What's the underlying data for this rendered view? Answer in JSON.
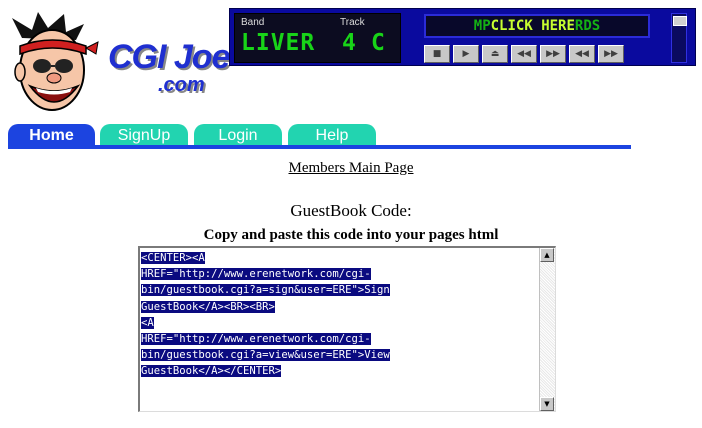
{
  "logo": {
    "text": "CGI Joe",
    "sub": ".com"
  },
  "player": {
    "band_label": "Band",
    "track_label": "Track",
    "band_value": "LIVER",
    "track_value": "4",
    "track_suffix": "C",
    "banner": {
      "pre": "MP",
      "highlight": "CLICK HERE",
      "post": "RDS"
    },
    "controls": [
      "stop-icon",
      "play-icon",
      "eject-icon",
      "rewind-icon",
      "fast-forward-icon",
      "previous-icon",
      "next-icon"
    ]
  },
  "nav": {
    "tabs": [
      "Home",
      "SignUp",
      "Login",
      "Help"
    ],
    "active": "Home"
  },
  "content": {
    "members_link": "Members Main Page",
    "title": "GuestBook Code:",
    "instructions": "Copy and paste this code into your pages html",
    "code_lines": [
      "<CENTER><A",
      "HREF=\"http://www.erenetwork.com/cgi-",
      "bin/guestbook.cgi?a=sign&user=ERE\">Sign",
      "GuestBook</A><BR><BR>",
      "<A",
      "HREF=\"http://www.erenetwork.com/cgi-",
      "bin/guestbook.cgi?a=view&user=ERE\">View",
      "GuestBook</A></CENTER>"
    ]
  },
  "colors": {
    "tab_active": "#1c44e0",
    "tab_inactive": "#22d4b0",
    "selection": "#0a0a80",
    "player_bg": "#0a0a9e",
    "lcd_text": "#18d418"
  }
}
